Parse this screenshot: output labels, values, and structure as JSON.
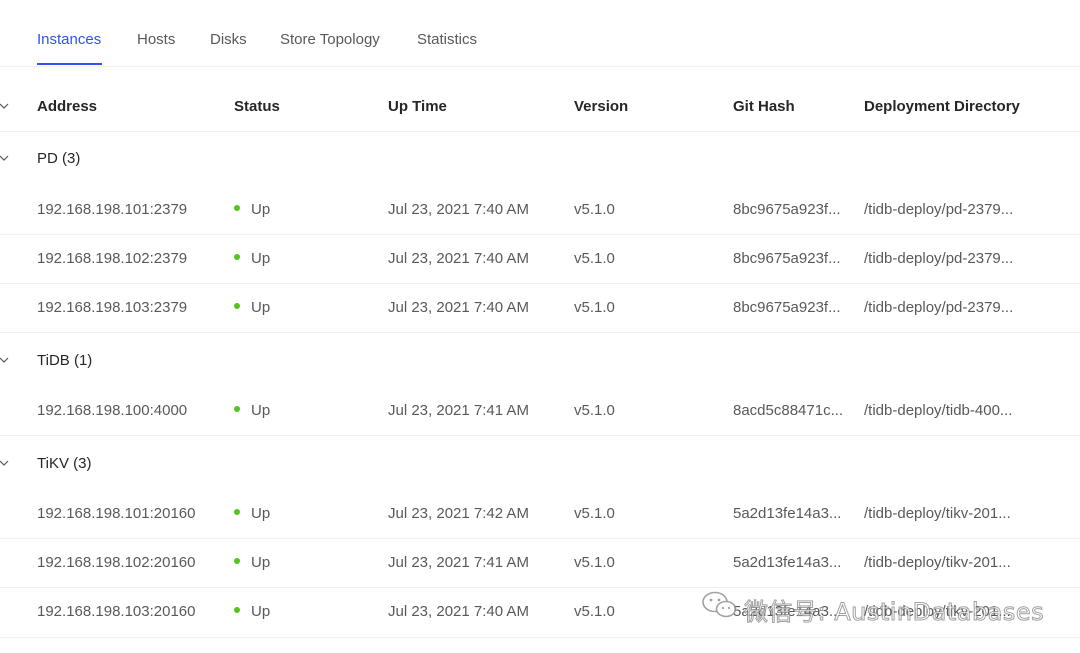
{
  "tabs": [
    "Instances",
    "Hosts",
    "Disks",
    "Store Topology",
    "Statistics"
  ],
  "columns": [
    "Address",
    "Status",
    "Up Time",
    "Version",
    "Git Hash",
    "Deployment Directory"
  ],
  "groups": [
    {
      "label": "PD (3)",
      "rows": [
        {
          "address": "192.168.198.101:2379",
          "status": "Up",
          "uptime": "Jul 23, 2021 7:40 AM",
          "version": "v5.1.0",
          "git": "8bc9675a923f...",
          "dir": "/tidb-deploy/pd-2379..."
        },
        {
          "address": "192.168.198.102:2379",
          "status": "Up",
          "uptime": "Jul 23, 2021 7:40 AM",
          "version": "v5.1.0",
          "git": "8bc9675a923f...",
          "dir": "/tidb-deploy/pd-2379..."
        },
        {
          "address": "192.168.198.103:2379",
          "status": "Up",
          "uptime": "Jul 23, 2021 7:40 AM",
          "version": "v5.1.0",
          "git": "8bc9675a923f...",
          "dir": "/tidb-deploy/pd-2379..."
        }
      ]
    },
    {
      "label": "TiDB (1)",
      "rows": [
        {
          "address": "192.168.198.100:4000",
          "status": "Up",
          "uptime": "Jul 23, 2021 7:41 AM",
          "version": "v5.1.0",
          "git": "8acd5c88471c...",
          "dir": "/tidb-deploy/tidb-400..."
        }
      ]
    },
    {
      "label": "TiKV (3)",
      "rows": [
        {
          "address": "192.168.198.101:20160",
          "status": "Up",
          "uptime": "Jul 23, 2021 7:42 AM",
          "version": "v5.1.0",
          "git": "5a2d13fe14a3...",
          "dir": "/tidb-deploy/tikv-201..."
        },
        {
          "address": "192.168.198.102:20160",
          "status": "Up",
          "uptime": "Jul 23, 2021 7:41 AM",
          "version": "v5.1.0",
          "git": "5a2d13fe14a3...",
          "dir": "/tidb-deploy/tikv-201..."
        },
        {
          "address": "192.168.198.103:20160",
          "status": "Up",
          "uptime": "Jul 23, 2021 7:40 AM",
          "version": "v5.1.0",
          "git": "5a2d13fe14a3...",
          "dir": "/tidb-deploy/tikv-201..."
        }
      ]
    }
  ],
  "watermark": "微信号: AustinDatabases",
  "colors": {
    "accent": "#2f54eb",
    "status_up": "#52c41a"
  }
}
